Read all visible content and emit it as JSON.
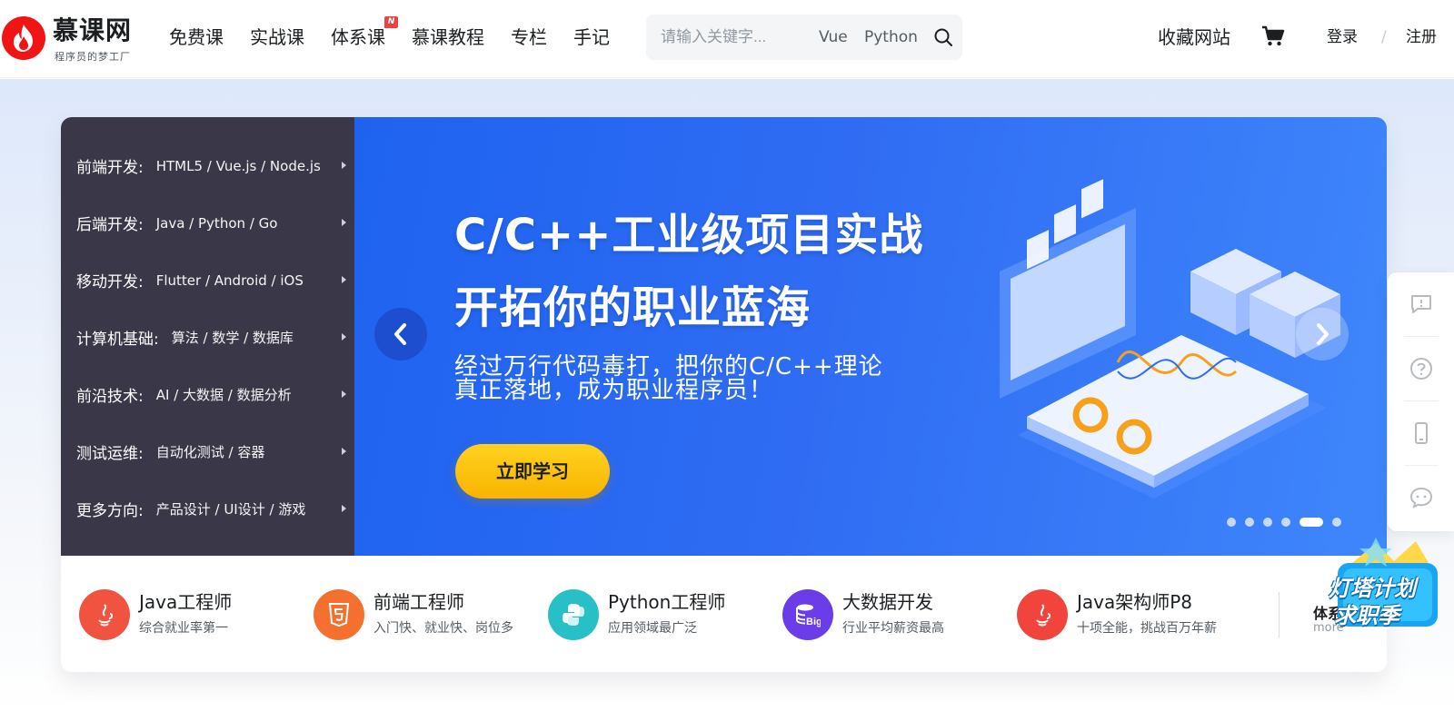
{
  "header": {
    "logo_text": "慕课网",
    "logo_slogan": "程序员的梦工厂",
    "nav": [
      {
        "label": "免费课"
      },
      {
        "label": "实战课"
      },
      {
        "label": "体系课",
        "badge": "N"
      },
      {
        "label": "慕课教程"
      },
      {
        "label": "专栏"
      },
      {
        "label": "手记"
      }
    ],
    "search": {
      "placeholder": "请输入关键字...",
      "tags": [
        "Vue",
        "Python"
      ]
    },
    "favorites": "收藏网站",
    "login": "登录",
    "separator": "/",
    "register": "注册"
  },
  "categories": [
    {
      "name": "前端开发:",
      "links": "HTML5 / Vue.js / Node.js"
    },
    {
      "name": "后端开发:",
      "links": "Java / Python / Go"
    },
    {
      "name": "移动开发:",
      "links": "Flutter / Android / iOS"
    },
    {
      "name": "计算机基础:",
      "links": "算法 / 数学 / 数据库"
    },
    {
      "name": "前沿技术:",
      "links": "AI / 大数据 / 数据分析"
    },
    {
      "name": "测试运维:",
      "links": "自动化测试 / 容器"
    },
    {
      "name": "更多方向:",
      "links": "产品设计 / UI设计 / 游戏"
    }
  ],
  "banner": {
    "title_line1": "C/C++工业级项目实战",
    "title_line2": "开拓你的职业蓝海",
    "sub_line1": "经过万行代码毒打，把你的C/C++理论",
    "sub_line2": "真正落地，成为职业程序员！",
    "cta": "立即学习",
    "slide_count": 6,
    "active_slide": 5
  },
  "paths": [
    {
      "title": "Java工程师",
      "desc": "综合就业率第一",
      "icon": "java-icon",
      "color": "#f05340"
    },
    {
      "title": "前端工程师",
      "desc": "入门快、就业快、岗位多",
      "icon": "html5-icon",
      "color": "#f5702e"
    },
    {
      "title": "Python工程师",
      "desc": "应用领域最广泛",
      "icon": "python-icon",
      "color": "#26c0c6"
    },
    {
      "title": "大数据开发",
      "desc": "行业平均薪资最高",
      "icon": "bigdata-icon",
      "color": "#6a3de8"
    },
    {
      "title": "Java架构师P8",
      "desc": "十项全能，挑战百万年薪",
      "icon": "java-icon",
      "color": "#f0443c"
    }
  ],
  "paths_more": {
    "title": "体系",
    "sub": "more"
  },
  "promo": {
    "line1": "灯塔计划",
    "line2": "求职季"
  },
  "side_tools": [
    "feedback-icon",
    "help-icon",
    "mobile-app-icon",
    "wechat-icon"
  ],
  "colors": {
    "menu_bg": "#3a3848",
    "banner_blue": "#2f6cf3",
    "cta_yellow": "#ffc400",
    "brand_red": "#f01414"
  }
}
